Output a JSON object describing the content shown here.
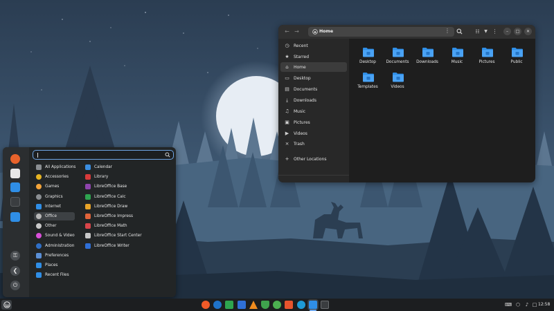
{
  "colors": {
    "folder_blue": "#2f8ee6",
    "accent": "#6fa6e6",
    "window_bg": "#1e1e1e",
    "sidebar_bg": "#282828",
    "menu_bg": "#222526"
  },
  "file_manager": {
    "path_label": "Home",
    "header_icons": [
      "back-arrow-icon",
      "forward-arrow-icon",
      "home-icon",
      "path-menu-icon",
      "search-icon",
      "view-list-icon",
      "view-dropdown-icon",
      "main-menu-icon",
      "minimize-icon",
      "maximize-icon",
      "close-icon"
    ],
    "sidebar": [
      {
        "label": "Recent",
        "icon": "recent-icon",
        "glyph": "◷"
      },
      {
        "label": "Starred",
        "icon": "star-icon",
        "glyph": "★"
      },
      {
        "label": "Home",
        "icon": "home-icon",
        "glyph": "⌂",
        "active": true
      },
      {
        "label": "Desktop",
        "icon": "desktop-icon",
        "glyph": "▭"
      },
      {
        "label": "Documents",
        "icon": "documents-icon",
        "glyph": "▤"
      },
      {
        "label": "Downloads",
        "icon": "downloads-icon",
        "glyph": "⤓"
      },
      {
        "label": "Music",
        "icon": "music-icon",
        "glyph": "♫"
      },
      {
        "label": "Pictures",
        "icon": "pictures-icon",
        "glyph": "▣"
      },
      {
        "label": "Videos",
        "icon": "videos-icon",
        "glyph": "▶"
      },
      {
        "label": "Trash",
        "icon": "trash-icon",
        "glyph": "⨯"
      },
      {
        "label": "Other Locations",
        "icon": "plus-icon",
        "glyph": "+"
      }
    ],
    "folders": [
      {
        "label": "Desktop",
        "icon": "desktop-folder-icon"
      },
      {
        "label": "Documents",
        "icon": "documents-folder-icon"
      },
      {
        "label": "Downloads",
        "icon": "downloads-folder-icon"
      },
      {
        "label": "Music",
        "icon": "music-folder-icon"
      },
      {
        "label": "Pictures",
        "icon": "pictures-folder-icon"
      },
      {
        "label": "Public",
        "icon": "public-folder-icon"
      },
      {
        "label": "Templates",
        "icon": "templates-folder-icon"
      },
      {
        "label": "Videos",
        "icon": "videos-folder-icon"
      }
    ]
  },
  "app_menu": {
    "search_value": "",
    "favorites": [
      {
        "name": "firefox-icon",
        "color": "#e8632b"
      },
      {
        "name": "software-center-icon",
        "color": "#e8e8e8"
      },
      {
        "name": "settings-icon",
        "color": "#2f8ee6"
      },
      {
        "name": "terminal-icon",
        "color": "#3a3d40"
      },
      {
        "name": "files-icon",
        "color": "#2f8ee6"
      }
    ],
    "session_buttons": [
      {
        "name": "lock-screen-button",
        "glyph": "⚿"
      },
      {
        "name": "logout-button",
        "glyph": "❮"
      },
      {
        "name": "power-button",
        "glyph": "⏻"
      }
    ],
    "categories": [
      {
        "label": "All Applications",
        "icon": "all-apps-icon",
        "color": "#8a8e92"
      },
      {
        "label": "Accessories",
        "icon": "accessories-icon",
        "color": "#e6b422"
      },
      {
        "label": "Games",
        "icon": "games-icon",
        "color": "#f3a43a"
      },
      {
        "label": "Graphics",
        "icon": "graphics-icon",
        "color": "#8a8e92"
      },
      {
        "label": "Internet",
        "icon": "internet-icon",
        "color": "#2f8ee6"
      },
      {
        "label": "Office",
        "icon": "office-icon",
        "color": "#b8b8b8",
        "active": true
      },
      {
        "label": "Other",
        "icon": "other-icon",
        "color": "#c8c8c8"
      },
      {
        "label": "Sound & Video",
        "icon": "sound-video-icon",
        "color": "#d84fd8"
      },
      {
        "label": "Administration",
        "icon": "administration-icon",
        "color": "#2f6fc6"
      },
      {
        "label": "Preferences",
        "icon": "preferences-icon",
        "color": "#5a8fd6"
      },
      {
        "label": "Places",
        "icon": "places-icon",
        "color": "#2f8ee6"
      },
      {
        "label": "Recent Files",
        "icon": "recent-files-icon",
        "color": "#2f8ee6"
      }
    ],
    "apps": [
      {
        "label": "Calendar",
        "icon": "calendar-icon",
        "color": "#3a8de0"
      },
      {
        "label": "Library",
        "icon": "library-icon",
        "color": "#d83a3a"
      },
      {
        "label": "LibreOffice Base",
        "icon": "libreoffice-base-icon",
        "color": "#8e44ad"
      },
      {
        "label": "LibreOffice Calc",
        "icon": "libreoffice-calc-icon",
        "color": "#2ea44f"
      },
      {
        "label": "LibreOffice Draw",
        "icon": "libreoffice-draw-icon",
        "color": "#e8a328"
      },
      {
        "label": "LibreOffice Impress",
        "icon": "libreoffice-impress-icon",
        "color": "#e0633a"
      },
      {
        "label": "LibreOffice Math",
        "icon": "libreoffice-math-icon",
        "color": "#d8454a"
      },
      {
        "label": "LibreOffice Start Center",
        "icon": "libreoffice-start-center-icon",
        "color": "#c8c8c8"
      },
      {
        "label": "LibreOffice Writer",
        "icon": "libreoffice-writer-icon",
        "color": "#2f6fd6"
      }
    ]
  },
  "taskbar": {
    "apps": [
      {
        "name": "brave-icon",
        "color": "#f05a28"
      },
      {
        "name": "thunderbird-icon",
        "color": "#1f73c9"
      },
      {
        "name": "libreoffice-calc-taskbar-icon",
        "color": "#2ea44f"
      },
      {
        "name": "libreoffice-writer-taskbar-icon",
        "color": "#2f6fd6"
      },
      {
        "name": "vlc-icon",
        "color": "#f08c1e"
      },
      {
        "name": "gufw-firewall-icon",
        "color": "#3fa34d"
      },
      {
        "name": "update-manager-icon",
        "color": "#4caf50"
      },
      {
        "name": "screenshot-tool-icon",
        "color": "#e8542d"
      },
      {
        "name": "krita-icon",
        "color": "#1e9ad6"
      },
      {
        "name": "files-taskbar-icon",
        "color": "#2f8ee6",
        "active": true
      },
      {
        "name": "terminal-taskbar-icon",
        "color": "#3a3d40"
      }
    ],
    "tray_icons": [
      "keyboard-layout-icon",
      "network-icon",
      "volume-icon",
      "notifications-icon"
    ],
    "clock": "12:58"
  }
}
